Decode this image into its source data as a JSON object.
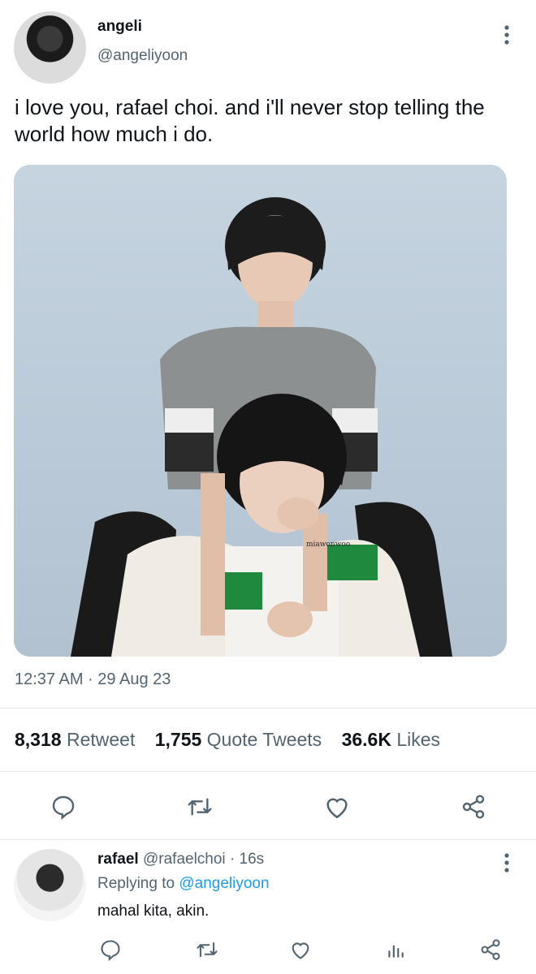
{
  "tweet": {
    "author_name": "angeli",
    "author_handle": "@angeliyoon",
    "text": "i love you, rafael choi. and i'll never stop telling the world how much i do.",
    "image_watermark": "miawonwoo",
    "timestamp": "12:37 AM · 29 Aug 23",
    "stats": {
      "retweets_count": "8,318",
      "retweets_label": "Retweet",
      "quotes_count": "1,755",
      "quotes_label": "Quote Tweets",
      "likes_count": "36.6K",
      "likes_label": "Likes"
    }
  },
  "reply": {
    "author_name": "rafael",
    "author_handle": "@rafaelchoi",
    "time": "· 16s",
    "replying_prefix": "Replying to",
    "replying_to": "@angeliyoon",
    "text": "mahal kita, akin."
  },
  "colors": {
    "accent": "#1d9bf0",
    "muted": "#536471",
    "text": "#0f1419"
  },
  "icons": [
    "more-vertical-icon",
    "reply-icon",
    "retweet-icon",
    "like-icon",
    "share-icon",
    "analytics-icon"
  ]
}
